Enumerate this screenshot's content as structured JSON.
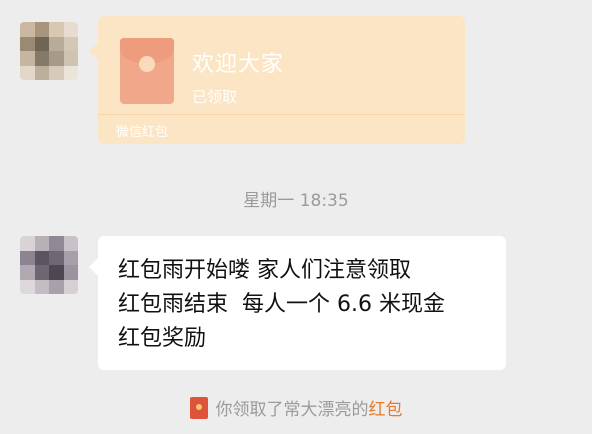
{
  "red_packet": {
    "title": "欢迎大家",
    "status": "已领取",
    "footer": "微信红包"
  },
  "timestamp": "星期一 18:35",
  "message": {
    "lines": [
      "红包雨开始喽 家人们注意领取",
      "红包雨结束  每人一个 6.6 米现金",
      "红包奖励"
    ]
  },
  "notice": {
    "prefix": "你领取了常大漂亮的",
    "link": "红包"
  },
  "colors": {
    "background": "#ededed",
    "packet_card": "#fbe5c4",
    "bubble": "#ffffff",
    "notice_link": "#e57a2c",
    "packet_icon": "#e0533b"
  },
  "avatar1": {
    "pixels": [
      "#cbb8a0",
      "#a8957b",
      "#d8c8b2",
      "#e6ddd0",
      "#9a8a74",
      "#6f6554",
      "#b9ab97",
      "#d3c7b6",
      "#c6b69f",
      "#857a68",
      "#a79b88",
      "#cfc3b1",
      "#e2d8ca",
      "#bcb09c",
      "#d6cbbb",
      "#ebe4d9"
    ]
  },
  "avatar2": {
    "pixels": [
      "#d9d3d5",
      "#b8b0b7",
      "#8f8895",
      "#c8c2c8",
      "#8c8591",
      "#5a5561",
      "#6e6874",
      "#a7a0aa",
      "#b0a9b2",
      "#6d6772",
      "#4c4750",
      "#9b949e",
      "#ddd8db",
      "#c2bcc3",
      "#a7a1aa",
      "#d5d0d3"
    ]
  }
}
